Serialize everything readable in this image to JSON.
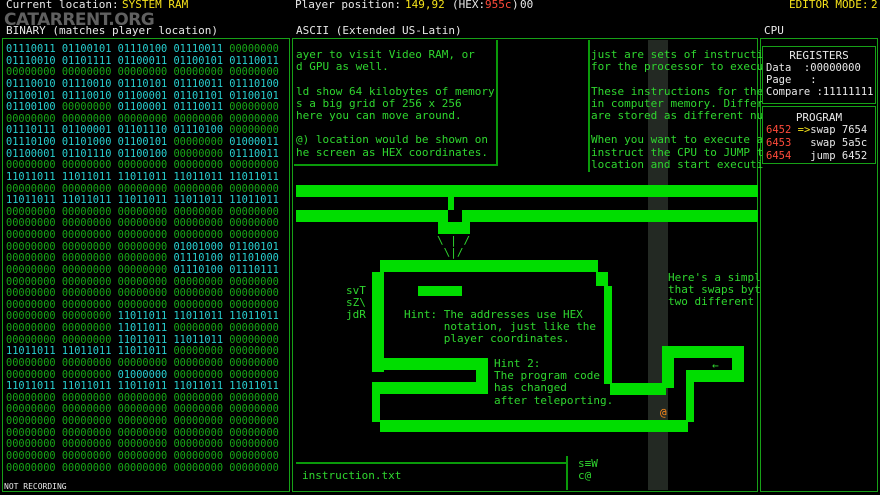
{
  "topbar": {
    "location_label": "Current location:",
    "location_value": "SYSTEM RAM",
    "position_label": "Player position:",
    "position_value": "149,92",
    "hex_open": "(HEX:",
    "hex_value": "955c",
    "hex_close": ")",
    "hex_suffix": "00",
    "editor_label": "EDITOR MODE:",
    "editor_value": "2"
  },
  "watermark": "CATARRENT.ORG",
  "headers": {
    "binary_title": "BINARY",
    "binary_note": "(matches player location)",
    "ascii_title": "ASCII",
    "ascii_note": "(Extended US-Latin)",
    "cpu_title": "CPU"
  },
  "binary_rows": [
    [
      "01110011",
      "01100101",
      "01110100",
      "01110011",
      "00000000"
    ],
    [
      "01110010",
      "01101111",
      "01100011",
      "01100101",
      "01110011"
    ],
    [
      "00000000",
      "00000000",
      "00000000",
      "00000000",
      "00000000"
    ],
    [
      "01110010",
      "01110010",
      "01110101",
      "01110011",
      "01110100"
    ],
    [
      "01100101",
      "01110010",
      "01100001",
      "01101101",
      "01100101"
    ],
    [
      "01100100",
      "00000000",
      "01100001",
      "01110011",
      "00000000"
    ],
    [
      "00000000",
      "00000000",
      "00000000",
      "00000000",
      "00000000"
    ],
    [
      "01110111",
      "01100001",
      "01101110",
      "01110100",
      "00000000"
    ],
    [
      "01110100",
      "01101000",
      "01100101",
      "00000000",
      "01000011"
    ],
    [
      "01100001",
      "01101110",
      "01100100",
      "00000000",
      "01110011"
    ],
    [
      "00000000",
      "00000000",
      "00000000",
      "00000000",
      "00000000"
    ],
    [
      "11011011",
      "11011011",
      "11011011",
      "11011011",
      "11011011"
    ],
    [
      "00000000",
      "00000000",
      "00000000",
      "00000000",
      "00000000"
    ],
    [
      "11011011",
      "11011011",
      "11011011",
      "11011011",
      "11011011"
    ],
    [
      "00000000",
      "00000000",
      "00000000",
      "00000000",
      "00000000"
    ],
    [
      "00000000",
      "00000000",
      "00000000",
      "00000000",
      "00000000"
    ],
    [
      "00000000",
      "00000000",
      "00000000",
      "00000000",
      "00000000"
    ],
    [
      "00000000",
      "00000000",
      "00000000",
      "01001000",
      "01100101"
    ],
    [
      "00000000",
      "00000000",
      "00000000",
      "01110100",
      "01101000"
    ],
    [
      "00000000",
      "00000000",
      "00000000",
      "01110100",
      "01110111"
    ],
    [
      "00000000",
      "00000000",
      "00000000",
      "00000000",
      "00000000"
    ],
    [
      "00000000",
      "00000000",
      "00000000",
      "00000000",
      "00000000"
    ],
    [
      "00000000",
      "00000000",
      "00000000",
      "00000000",
      "00000000"
    ],
    [
      "00000000",
      "00000000",
      "11011011",
      "11011011",
      "11011011"
    ],
    [
      "00000000",
      "00000000",
      "11011011",
      "00000000",
      "00000000"
    ],
    [
      "00000000",
      "00000000",
      "11011011",
      "11011011",
      "00000000"
    ],
    [
      "11011011",
      "11011011",
      "11011011",
      "00000000",
      "00000000"
    ],
    [
      "00000000",
      "00000000",
      "00000000",
      "00000000",
      "00000000"
    ],
    [
      "00000000",
      "00000000",
      "01000000",
      "00000000",
      "00000000"
    ],
    [
      "11011011",
      "11011011",
      "11011011",
      "11011011",
      "11011011"
    ],
    [
      "00000000",
      "00000000",
      "00000000",
      "00000000",
      "00000000"
    ],
    [
      "00000000",
      "00000000",
      "00000000",
      "00000000",
      "00000000"
    ],
    [
      "00000000",
      "00000000",
      "00000000",
      "00000000",
      "00000000"
    ],
    [
      "00000000",
      "00000000",
      "00000000",
      "00000000",
      "00000000"
    ],
    [
      "00000000",
      "00000000",
      "00000000",
      "00000000",
      "00000000"
    ],
    [
      "00000000",
      "00000000",
      "00000000",
      "00000000",
      "00000000"
    ],
    [
      "00000000",
      "00000000",
      "00000000",
      "00000000",
      "00000000"
    ]
  ],
  "ascii": {
    "text_left": "ayer to visit Video RAM, or\nd GPU as well.\n\nld show 64 kilobytes of memory\ns a big grid of 256 x 256\nhere you can move around.\n\n@) location would be shown on\nhe screen as HEX coordinates.",
    "text_right": "just are sets of instructi\nfor the processor to execu\n\nThese instructions for the\nin computer memory. Differ\nare stored as different nu\n\nWhen you want to execute a\ninstruct the CPU to JUMP t\nlocation and start executi",
    "funnel": "\\ | /\n \\|/",
    "left_glyphs": "svT\nsZ\\\njdR",
    "right_note": "Here's a simpl\nthat swaps byt\ntwo different",
    "hint1": "Hint: The addresses use HEX\n      notation, just like the\n      player coordinates.",
    "hint2": "Hint 2:\nThe program code\nhas changed\nafter teleporting.",
    "arrow": "←",
    "filename": "instruction.txt",
    "bottom_glyphs": "s≡W\nc@",
    "player": "@"
  },
  "cpu": {
    "registers_title": "REGISTERS",
    "registers": [
      "Data  :00000000",
      "Page   :",
      "Compare :11111111"
    ],
    "program_title": "PROGRAM",
    "program": [
      {
        "addr": "6452",
        "ptr": " =>",
        "ins": "swap 7654"
      },
      {
        "addr": "6453",
        "ptr": "   ",
        "ins": "swap 5a5c"
      },
      {
        "addr": "6454",
        "ptr": "   ",
        "ins": "jump 6452"
      }
    ]
  },
  "status": "NOT RECORDING",
  "colors": {
    "wall": "#00dd00",
    "text": "#2fd62f",
    "binary_on": "#28d0d0",
    "highlight_yellow": "#f5e21a",
    "highlight_red": "#ff4a3a",
    "player": "#ff8a1a"
  }
}
